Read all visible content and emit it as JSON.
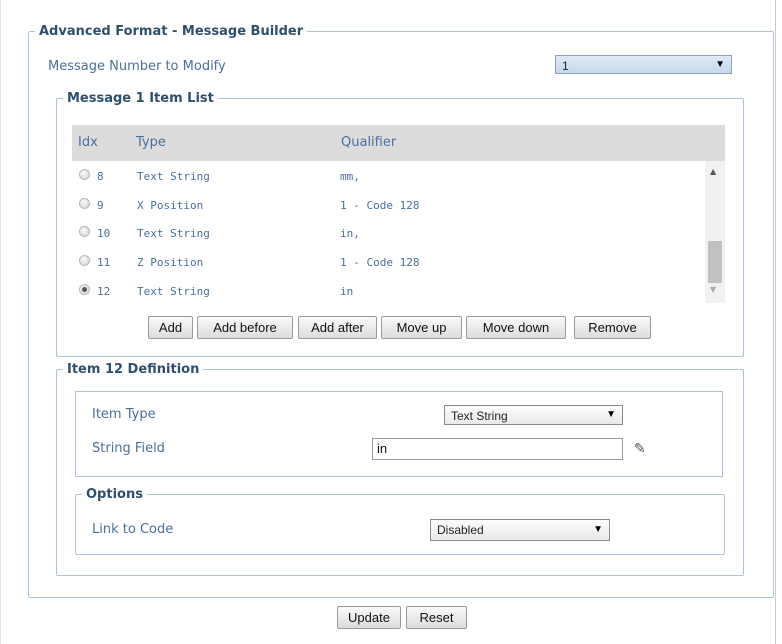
{
  "builder": {
    "legend": "Advanced Format - Message Builder",
    "message_number_label": "Message Number to Modify",
    "message_number_value": "1"
  },
  "item_list": {
    "legend": "Message 1 Item List",
    "columns": [
      "Idx",
      "Type",
      "Qualifier"
    ],
    "rows": [
      {
        "idx": "8",
        "type": "Text String",
        "qualifier": "mm,",
        "selected": false
      },
      {
        "idx": "9",
        "type": "X Position",
        "qualifier": "1 - Code 128",
        "selected": false
      },
      {
        "idx": "10",
        "type": "Text String",
        "qualifier": "in,",
        "selected": false
      },
      {
        "idx": "11",
        "type": "Z Position",
        "qualifier": "1 - Code 128",
        "selected": false
      },
      {
        "idx": "12",
        "type": "Text String",
        "qualifier": "in",
        "selected": true
      }
    ],
    "buttons": {
      "add": "Add",
      "add_before": "Add before",
      "add_after": "Add after",
      "move_up": "Move up",
      "move_down": "Move down",
      "remove": "Remove"
    }
  },
  "definition": {
    "legend": "Item 12 Definition",
    "item_type_label": "Item Type",
    "item_type_value": "Text String",
    "string_field_label": "String Field",
    "string_field_value": "in"
  },
  "options": {
    "legend": "Options",
    "link_label": "Link to Code",
    "link_value": "Disabled"
  },
  "footer": {
    "update": "Update",
    "reset": "Reset"
  },
  "icons": {
    "dropdown": "triangle-down-icon",
    "edit": "pencil-icon",
    "scroll_up": "arrow-up-icon",
    "scroll_down": "arrow-down-icon"
  }
}
